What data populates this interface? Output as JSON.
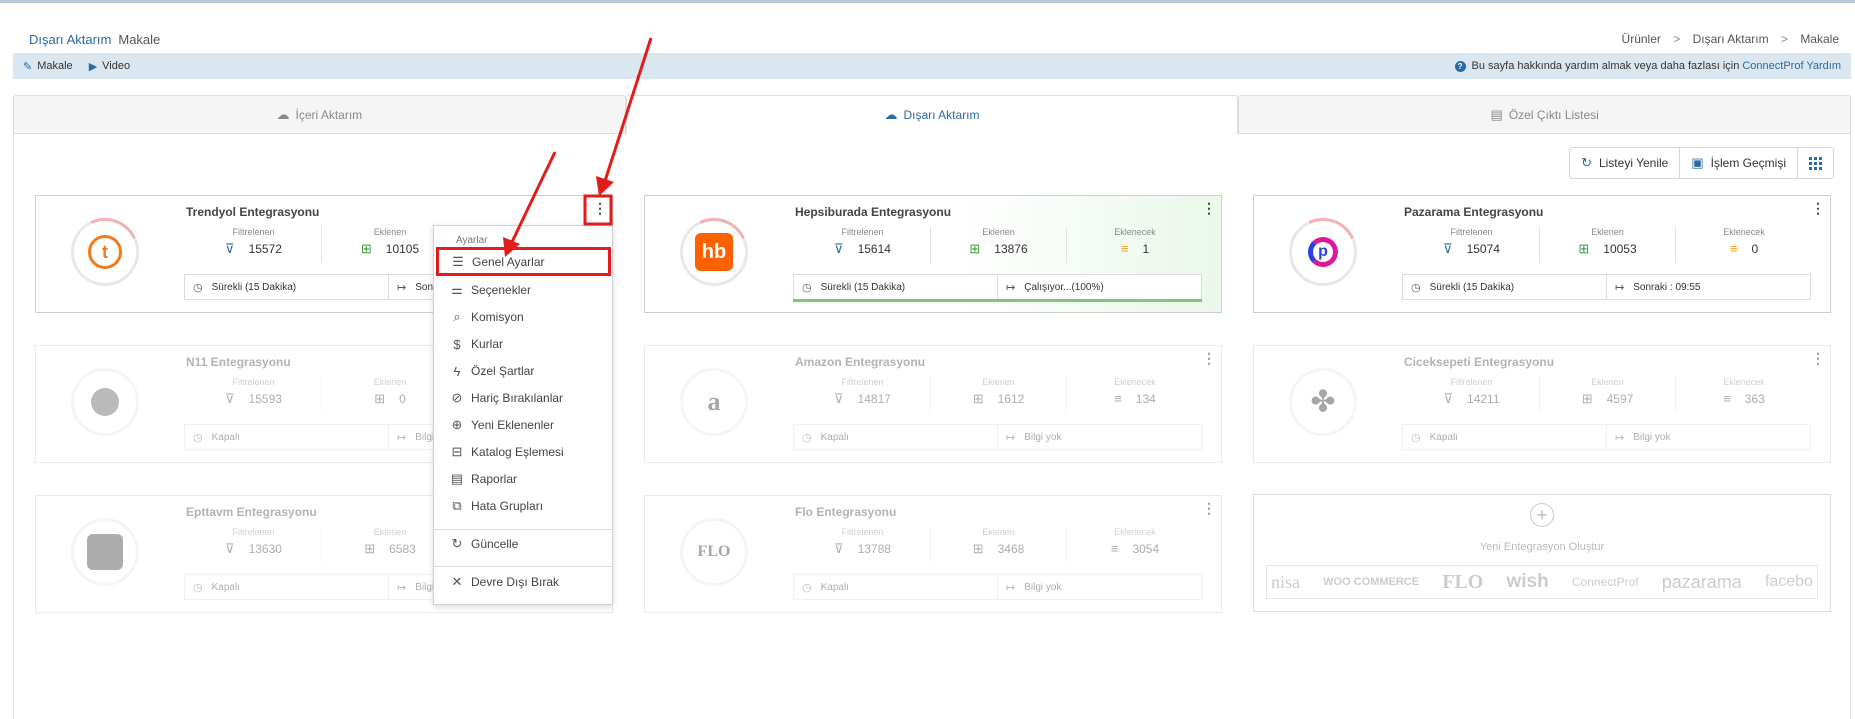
{
  "header": {
    "title": "Dışarı Aktarım",
    "subtitle": "Makale",
    "breadcrumbs": [
      "Ürünler",
      "Dışarı Aktarım",
      "Makale"
    ],
    "crumb_sep": ">"
  },
  "helpbar": {
    "makale": "Makale",
    "video": "Video",
    "help_text": "Bu sayfa hakkında yardım almak veya daha fazlası için",
    "help_link": "ConnectProf Yardım"
  },
  "tabs": {
    "import": "İçeri Aktarım",
    "export": "Dışarı Aktarım",
    "custom": "Özel Çıktı Listesi"
  },
  "toolbar": {
    "refresh": "Listeyi Yenile",
    "history": "İşlem Geçmişi"
  },
  "labels": {
    "filtered": "Filtrelenen",
    "added": "Eklenen",
    "to_add": "Eklenecek"
  },
  "cards": [
    {
      "name": "Trendyol Entegrasyonu",
      "filtered": "15572",
      "added": "10105",
      "schedule": "Sürekli (15 Dakika)",
      "next": "Sonr"
    },
    {
      "name": "Hepsiburada Entegrasyonu",
      "filtered": "15614",
      "added": "13876",
      "to_add": "1",
      "schedule": "Sürekli (15 Dakika)",
      "next": "Çalışıyor...(100%)"
    },
    {
      "name": "Pazarama Entegrasyonu",
      "filtered": "15074",
      "added": "10053",
      "to_add": "0",
      "schedule": "Sürekli (15 Dakika)",
      "next": "Sonraki : 09:55"
    },
    {
      "name": "N11 Entegrasyonu",
      "filtered": "15593",
      "added": "0",
      "schedule": "Kapalı",
      "next": "Bilgi"
    },
    {
      "name": "Amazon Entegrasyonu",
      "filtered": "14817",
      "added": "1612",
      "to_add": "134",
      "schedule": "Kapalı",
      "next": "Bilgi yok"
    },
    {
      "name": "Ciceksepeti Entegrasyonu",
      "filtered": "14211",
      "added": "4597",
      "to_add": "363",
      "schedule": "Kapalı",
      "next": "Bilgi yok"
    },
    {
      "name": "Epttavm Entegrasyonu",
      "filtered": "13630",
      "added": "6583",
      "schedule": "Kapalı",
      "next": "Bilgi"
    },
    {
      "name": "Flo Entegrasyonu",
      "filtered": "13788",
      "added": "3468",
      "to_add": "3054",
      "schedule": "Kapalı",
      "next": "Bilgi yok"
    }
  ],
  "logos": {
    "trendyol": "t",
    "hepsiburada": "hb",
    "pazarama": "p",
    "amazon": "a",
    "flo": "FLO"
  },
  "new_card": {
    "title": "Yeni Entegrasyon Oluştur",
    "brands": [
      "nisa",
      "WOO COMMERCE",
      "FLO",
      "wish",
      "ConnectProf",
      "pazarama",
      "facebo"
    ]
  },
  "menu": {
    "header": "Ayarlar",
    "items": [
      "Genel Ayarlar",
      "Seçenekler",
      "Komisyon",
      "Kurlar",
      "Özel Şartlar",
      "Hariç Bırakılanlar",
      "Yeni Eklenenler",
      "Katalog Eşlemesi",
      "Raporlar",
      "Hata Grupları",
      "Güncelle",
      "Devre Dışı Bırak"
    ]
  },
  "colors": {
    "accent": "#2a6aa5",
    "annotation": "#e21b1b",
    "success": "#7dc67d"
  }
}
